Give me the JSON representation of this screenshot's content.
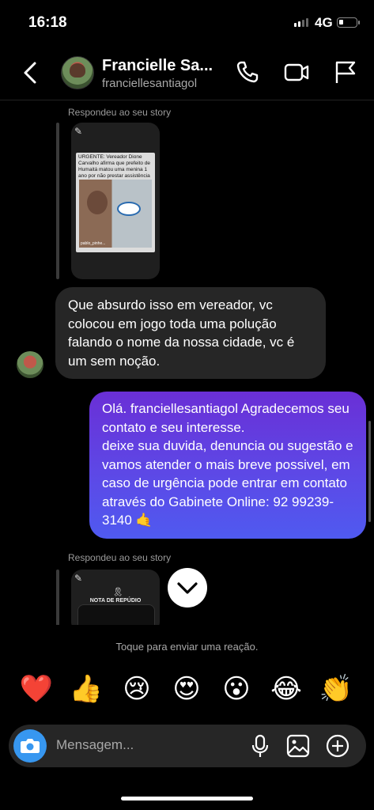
{
  "status_bar": {
    "time": "16:18",
    "network": "4G"
  },
  "header": {
    "name": "Francielle Sa...",
    "username": "franciellesantiagol"
  },
  "chat": {
    "story_reply_1": {
      "caption": "Respondeu ao seu story",
      "post_headline": "URGENTE: Vereador Dione Carvalho afirma que prefeito de Humaitá matou uma menina 1 ano por não prestar assistência",
      "post_handle": "pablo_pinhe..."
    },
    "incoming_message": "Que absurdo isso em vereador, vc colocou em jogo toda uma polução falando o nome da nossa cidade, vc é um sem noção.",
    "outgoing_message": {
      "line1": "Olá.  franciellesantiagol  Agradecemos seu contato e seu interesse.",
      "line2": "deixe sua duvida, denuncia ou sugestão e vamos atender o mais breve possivel, em caso de urgência pode entrar em contato através do Gabinete Online: 92 99239-3140 🤙"
    },
    "story_reply_2": {
      "caption": "Respondeu ao seu story",
      "post_title": "NOTA DE REPÚDIO"
    }
  },
  "reactions": {
    "hint": "Toque para enviar uma reação.",
    "emojis": [
      "❤️",
      "👍",
      "😢",
      "😍",
      "😮",
      "😂",
      "👏"
    ]
  },
  "composer": {
    "placeholder": "Mensagem..."
  },
  "colors": {
    "accent_blue": "#3797f0",
    "outgoing_gradient_start": "#6a2fd6",
    "outgoing_gradient_end": "#4f5af0",
    "incoming_bubble": "#262626"
  },
  "icons": [
    "back-icon",
    "phone-icon",
    "video-icon",
    "flag-icon",
    "camera-icon",
    "mic-icon",
    "image-icon",
    "plus-icon",
    "chevron-down-icon"
  ]
}
